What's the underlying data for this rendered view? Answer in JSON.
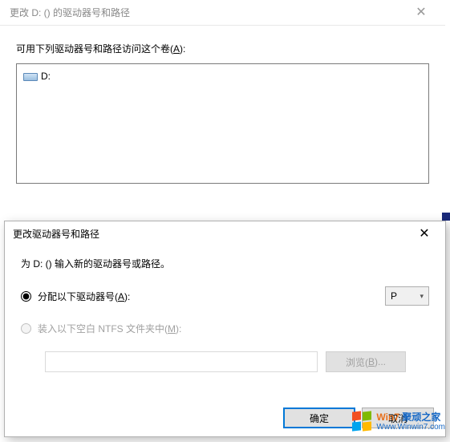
{
  "dlg1": {
    "title": "更改 D: () 的驱动器号和路径",
    "prompt": "可用下列驱动器号和路径访问这个卷(",
    "prompt_key": "A",
    "prompt_tail": "):",
    "items": [
      {
        "label": "D:"
      }
    ]
  },
  "dlg2": {
    "title": "更改驱动器号和路径",
    "prompt": "为 D: () 输入新的驱动器号或路径。",
    "opt_assign_pre": "分配以下驱动器号(",
    "opt_assign_key": "A",
    "opt_assign_post": "):",
    "drive_letter": "P",
    "opt_mount_pre": "装入以下空白 NTFS 文件夹中(",
    "opt_mount_key": "M",
    "opt_mount_post": "):",
    "browse_pre": "浏览(",
    "browse_key": "B",
    "browse_post": ")...",
    "ok": "确定",
    "cancel": "取消"
  },
  "watermark": {
    "brand_a": "Win7",
    "brand_b": "聚顽之家",
    "url": "Www.Winwin7.com"
  }
}
